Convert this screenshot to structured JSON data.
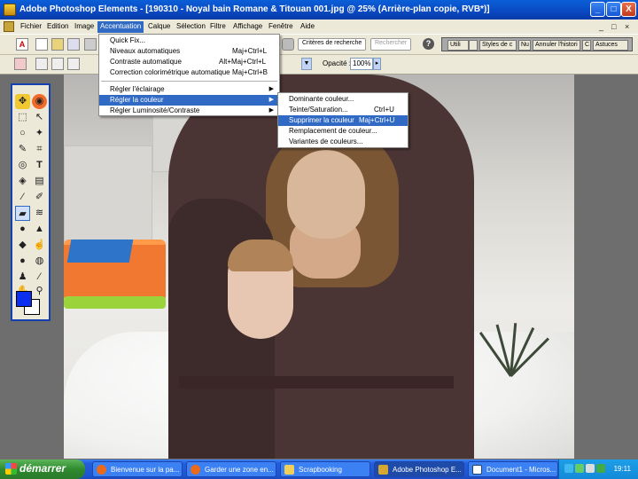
{
  "window": {
    "title": "Adobe Photoshop Elements - [190310 - Noyal bain Romane & Titouan 001.jpg @ 25% (Arrière-plan copie, RVB*)]",
    "minimize": "_",
    "maximize": "□",
    "close": "X"
  },
  "menubar": {
    "items": [
      "Fichier",
      "Edition",
      "Image",
      "Accentuation",
      "Calque",
      "Sélection",
      "Filtre",
      "Affichage",
      "Fenêtre",
      "Aide"
    ],
    "active": "Accentuation",
    "doc_controls": [
      "_",
      "□",
      "×"
    ]
  },
  "toolbar": {
    "search_label": "Critères de recherche",
    "search_button": "Rechercher",
    "help": "?",
    "palette_tabs": [
      "Utili",
      "",
      "Styles de c",
      "Nu",
      "Annuler l'histori",
      "C",
      "Astuces"
    ]
  },
  "options": {
    "opacity_label": "Opacité :",
    "opacity_value": "100%"
  },
  "accentuation_menu": {
    "items": [
      {
        "label": "Quick Fix...",
        "shortcut": ""
      },
      {
        "label": "Niveaux automatiques",
        "shortcut": "Maj+Ctrl+L"
      },
      {
        "label": "Contraste automatique",
        "shortcut": "Alt+Maj+Ctrl+L"
      },
      {
        "label": "Correction colorimétrique automatique",
        "shortcut": "Maj+Ctrl+B"
      },
      {
        "label": "Régler l'éclairage",
        "shortcut": ""
      },
      {
        "label": "Régler la couleur",
        "shortcut": ""
      },
      {
        "label": "Régler Luminosité/Contraste",
        "shortcut": ""
      }
    ]
  },
  "color_submenu": {
    "items": [
      {
        "label": "Dominante couleur...",
        "shortcut": ""
      },
      {
        "label": "Teinte/Saturation...",
        "shortcut": "Ctrl+U"
      },
      {
        "label": "Supprimer la couleur",
        "shortcut": "Maj+Ctrl+U"
      },
      {
        "label": "Remplacement de couleur...",
        "shortcut": ""
      },
      {
        "label": "Variantes de couleurs...",
        "shortcut": ""
      }
    ]
  },
  "toolbox": {
    "foreground_color": "#0b2ff0",
    "background_color": "#ffffff"
  },
  "taskbar": {
    "start_label": "démarrer",
    "tasks": [
      {
        "label": "Bienvenue sur la pa...",
        "icon": "firefox-icon"
      },
      {
        "label": "Garder une zone en...",
        "icon": "firefox-icon"
      },
      {
        "label": "Scrapbooking",
        "icon": "folder-icon"
      },
      {
        "label": "Adobe Photoshop E...",
        "icon": "photoshop-icon"
      },
      {
        "label": "Document1 - Micros...",
        "icon": "word-icon"
      }
    ],
    "clock": "19:11"
  }
}
